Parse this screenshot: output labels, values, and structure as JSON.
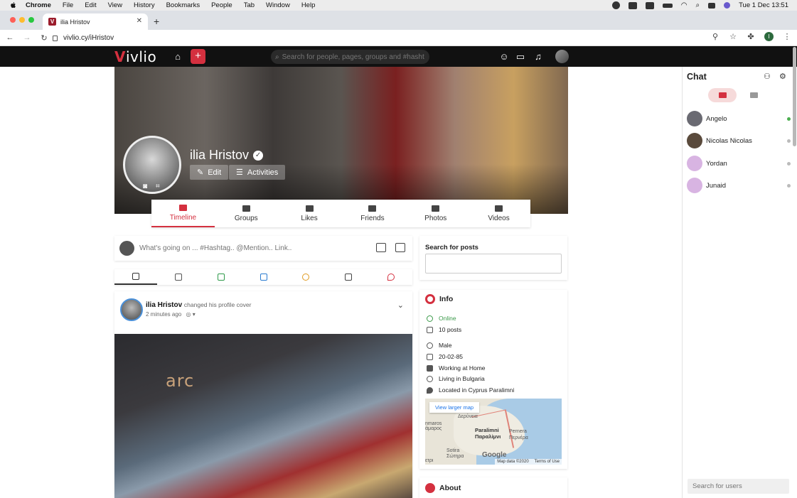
{
  "os_menubar": {
    "app": "Chrome",
    "items": [
      "File",
      "Edit",
      "View",
      "History",
      "Bookmarks",
      "People",
      "Tab",
      "Window",
      "Help"
    ],
    "clock": "Tue 1 Dec  13:51"
  },
  "browser": {
    "tab_title": "ilia Hristov",
    "url": "vivlio.cy/iHristov"
  },
  "site": {
    "logo": "ivlio",
    "logo_accent": "V",
    "search_placeholder": "Search for people, pages, groups and #hashtags",
    "accent_color": "#d4303f"
  },
  "profile": {
    "name": "ilia Hristov",
    "edit_label": "Edit",
    "activities_label": "Activities",
    "tabs": [
      {
        "label": "Timeline",
        "icon": "timeline-icon",
        "active": true
      },
      {
        "label": "Groups",
        "icon": "groups-icon"
      },
      {
        "label": "Likes",
        "icon": "likes-icon"
      },
      {
        "label": "Friends",
        "icon": "friends-icon"
      },
      {
        "label": "Photos",
        "icon": "photos-icon"
      },
      {
        "label": "Videos",
        "icon": "videos-icon"
      }
    ]
  },
  "composer": {
    "placeholder": "What's going on ... #Hashtag.. @Mention.. Link.."
  },
  "post_types": [
    "text-icon",
    "list-icon",
    "image-icon",
    "video-icon",
    "activity-icon",
    "file-icon",
    "location-icon"
  ],
  "post": {
    "author": "ilia Hristov",
    "action": "changed his profile cover",
    "time": "2 minutes ago",
    "photo_sign": "arc"
  },
  "search_posts": {
    "title": "Search for posts"
  },
  "info": {
    "title": "Info",
    "status": "Online",
    "posts": "10 posts",
    "gender": "Male",
    "birthday": "20-02-85",
    "work": "Working at Home",
    "living": "Living in Bulgaria",
    "located": "Located in Cyprus Paralimni",
    "map": {
      "view_larger": "View larger map",
      "labels": {
        "deryneia": "Δερύνεια",
        "maros": "nmaros\nάμαρος",
        "paralimni": "Paralimni\nΠαραλίμνι",
        "pernera": "Pernera\nΠερνέρα",
        "sotira": "Sotira\nΣώτηρα",
        "petri": "ετρι"
      },
      "google": "Google",
      "data": "Map data ©2020",
      "terms": "Terms of Use"
    }
  },
  "about": {
    "title": "About"
  },
  "chat": {
    "title": "Chat",
    "contacts": [
      {
        "name": "Angelo",
        "online": true,
        "color": "#6a6a72"
      },
      {
        "name": "Nicolas Nicolas",
        "online": false,
        "color": "#5a4a3c"
      },
      {
        "name": "Yordan",
        "online": false,
        "color": "#c99bd6"
      },
      {
        "name": "Junaid",
        "online": false,
        "color": "#c99bd6"
      }
    ],
    "search_placeholder": "Search for users"
  }
}
